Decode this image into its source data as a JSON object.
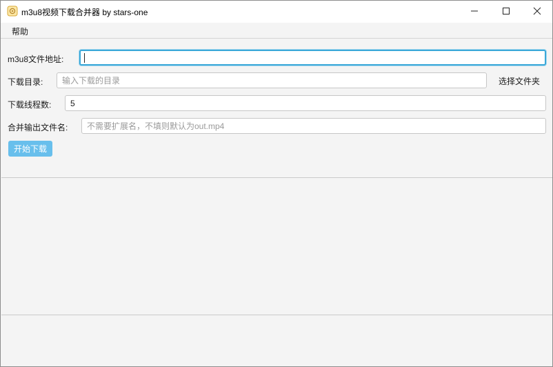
{
  "window": {
    "title": "m3u8视频下载合并器 by stars-one",
    "icons": {
      "app": "app-icon",
      "minimize": "minimize-icon",
      "maximize": "maximize-icon",
      "close": "close-icon"
    }
  },
  "menu": {
    "items": [
      {
        "label": "帮助"
      }
    ]
  },
  "form": {
    "url": {
      "label": "m3u8文件地址:",
      "value": "",
      "placeholder": ""
    },
    "dir": {
      "label": "下载目录:",
      "value": "",
      "placeholder": "输入下载的目录",
      "choose_label": "选择文件夹"
    },
    "threads": {
      "label": "下载线程数:",
      "value": "5"
    },
    "output": {
      "label": "合并输出文件名:",
      "value": "",
      "placeholder": "不需要扩展名，不填则默认为out.mp4"
    },
    "start_label": "开始下载"
  },
  "log": {
    "text": ""
  },
  "colors": {
    "accent": "#3aa8d8",
    "button": "#68bfec"
  }
}
